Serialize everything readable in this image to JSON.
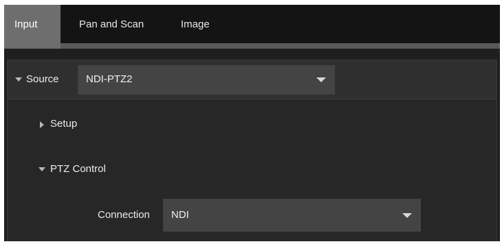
{
  "tabs": [
    {
      "label": "Input",
      "active": true
    },
    {
      "label": "Pan and Scan",
      "active": false
    },
    {
      "label": "Image",
      "active": false
    }
  ],
  "source": {
    "label": "Source",
    "value": "NDI-PTZ2",
    "expanded": true
  },
  "sections": {
    "setup": {
      "label": "Setup",
      "expanded": false
    },
    "ptz_control": {
      "label": "PTZ Control",
      "expanded": true
    }
  },
  "connection": {
    "label": "Connection",
    "value": "NDI"
  },
  "icons": {
    "source_toggle": "chevron-down-icon",
    "setup_toggle": "chevron-right-icon",
    "ptz_toggle": "chevron-down-icon",
    "dropdown_caret": "chevron-down-icon"
  },
  "colors": {
    "background": "#1f1f1f",
    "tab_active": "#6e6e6e",
    "dropdown": "#444444"
  }
}
